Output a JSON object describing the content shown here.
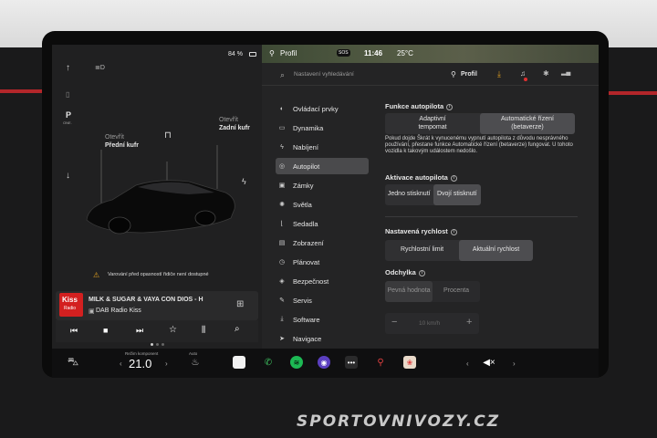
{
  "status": {
    "battery": "84 %",
    "profile": "Profil",
    "time": "11:46",
    "temp": "25°C",
    "sos": "SOS"
  },
  "car_panel": {
    "park_label": "P",
    "park_sub": "ONE.",
    "front_trunk_line1": "Otevřít",
    "front_trunk_line2": "Přední kufr",
    "rear_trunk_line1": "Otevřít",
    "rear_trunk_line2": "Zadní kufr",
    "warning": "Varování před opasností řidiče není dostupné"
  },
  "media": {
    "logo_text": "Kiss",
    "logo_sub": "Radio",
    "title": "MILK & SUGAR & VAYA CON DIOS - H",
    "source": "DAB Radio Kiss"
  },
  "search": {
    "placeholder": "Nastavení vyhledávání",
    "profile": "Profil"
  },
  "menu": [
    {
      "icon": "toggle-icon",
      "glyph": "◐",
      "label": "Ovládací prvky"
    },
    {
      "icon": "car-icon",
      "glyph": "▭",
      "label": "Dynamika"
    },
    {
      "icon": "bolt-icon",
      "glyph": "ϟ",
      "label": "Nabíjení"
    },
    {
      "icon": "steering-icon",
      "glyph": "◎",
      "label": "Autopilot"
    },
    {
      "icon": "lock-icon",
      "glyph": "▣",
      "label": "Zámky"
    },
    {
      "icon": "light-icon",
      "glyph": "✺",
      "label": "Světla"
    },
    {
      "icon": "seat-icon",
      "glyph": "⌊",
      "label": "Sedadla"
    },
    {
      "icon": "display-icon",
      "glyph": "▤",
      "label": "Zobrazení"
    },
    {
      "icon": "clock-icon",
      "glyph": "◷",
      "label": "Plánovat"
    },
    {
      "icon": "shield-icon",
      "glyph": "◈",
      "label": "Bezpečnost"
    },
    {
      "icon": "wrench-icon",
      "glyph": "✎",
      "label": "Servis"
    },
    {
      "icon": "download-icon",
      "glyph": "⤓",
      "label": "Software"
    },
    {
      "icon": "navigation-icon",
      "glyph": "➤",
      "label": "Navigace"
    }
  ],
  "autopilot": {
    "features_title": "Funkce autopilota",
    "option_adaptive_line1": "Adaptivní",
    "option_adaptive_line2": "tempomat",
    "option_auto_line1": "Automatické řízení",
    "option_auto_line2": "(betaverze)",
    "description": "Pokud dojde Škrát k vynucenému vypnutí autopilota z důvodu nesprávného používání, přestane funkce Automatické řízení (betaverze) fungovat. U tohoto vozidla k takovým událostem nedošlo.",
    "activation_title": "Aktivace autopilota",
    "single_press": "Jedno stisknutí",
    "double_press": "Dvojí stisknutí",
    "speed_title": "Nastavená rychlost",
    "speed_limit": "Rychlostní limit",
    "current_speed": "Aktuální rychlost",
    "offset_title": "Odchylka",
    "fixed_value": "Pevná hodnota",
    "percent": "Procenta",
    "offset_value": "10 km/h",
    "minus": "−",
    "plus": "+"
  },
  "climate": {
    "label": "Režim komponent",
    "temp": "21.0",
    "auto_label": "Auto"
  },
  "watermark": "SPORTOVNIVOZY.CZ"
}
